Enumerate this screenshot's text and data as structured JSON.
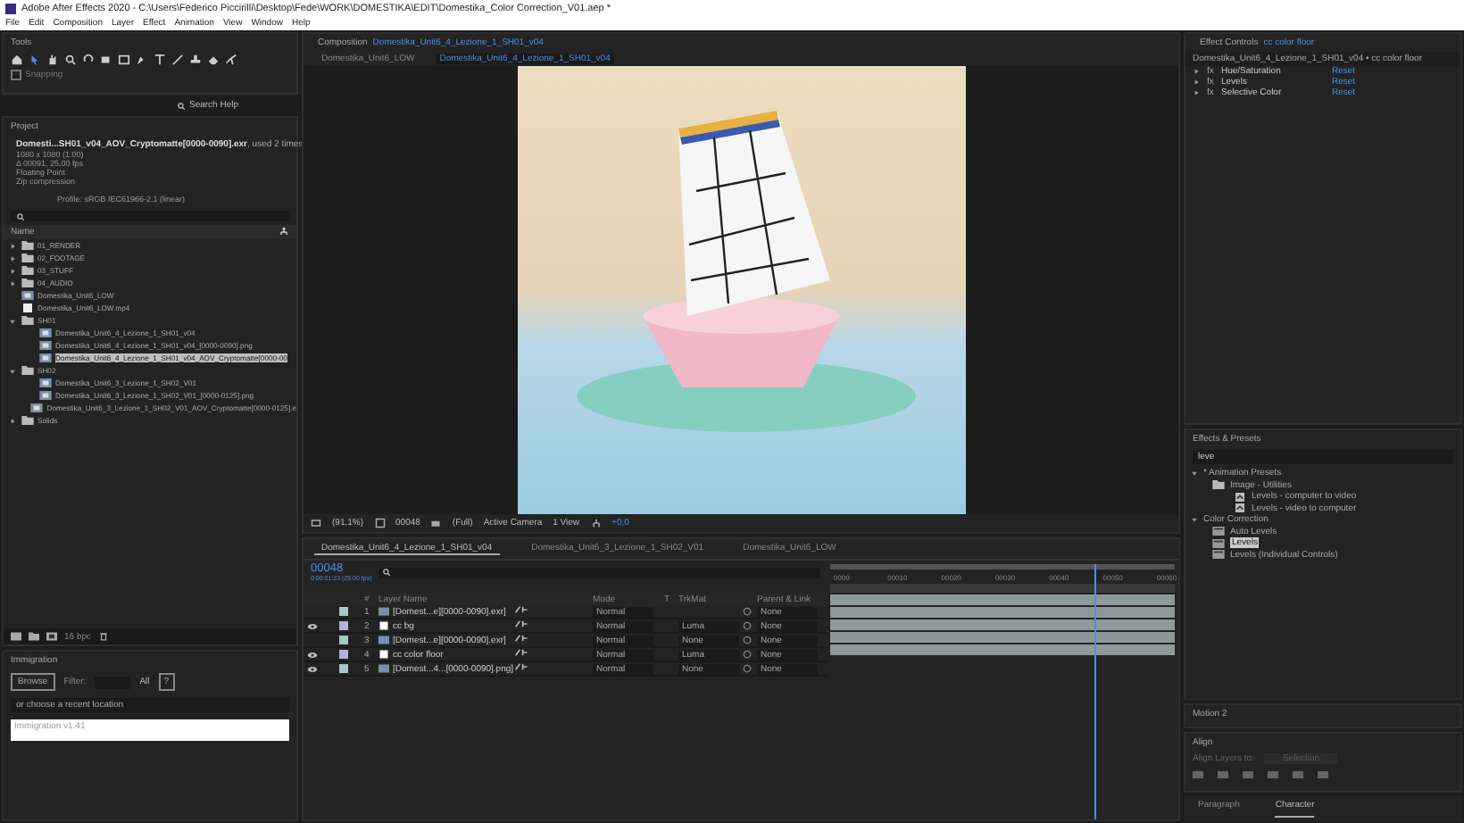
{
  "window": {
    "title": "Adobe After Effects 2020 - C:\\Users\\Federico Piccirilli\\Desktop\\Fede\\WORK\\DOMESTIKA\\EDIT\\Domestika_Color Correction_V01.aep *"
  },
  "menu": [
    "File",
    "Edit",
    "Composition",
    "Layer",
    "Effect",
    "Animation",
    "View",
    "Window",
    "Help"
  ],
  "tools": {
    "title": "Tools",
    "snapping": {
      "label": "Snapping",
      "checked": false
    },
    "search_placeholder": "Search Help"
  },
  "project": {
    "title": "Project",
    "selected_name": "Domesti...SH01_v04_AOV_Cryptomatte[0000-0090].exr",
    "used": ", used 2 times",
    "details": [
      "1080 x 1080 (1.00)",
      "Δ 00091, 25,00 fps",
      "Floating Point",
      "Zip compression"
    ],
    "profile": "Profile: sRGB IEC61966-2.1 (linear)",
    "column": "Name",
    "bpc": "16 bpc",
    "items": [
      {
        "name": "01_RENDER",
        "kind": "folder",
        "expanded": false,
        "selected": false
      },
      {
        "name": "02_FOOTAGE",
        "kind": "folder",
        "expanded": false,
        "selected": false
      },
      {
        "name": "03_STUFF",
        "kind": "folder",
        "expanded": false,
        "selected": false
      },
      {
        "name": "04_AUDIO",
        "kind": "folder",
        "expanded": false,
        "selected": false
      },
      {
        "name": "Domestika_Unit6_LOW",
        "kind": "comp",
        "selected": false
      },
      {
        "name": "Domestika_Unit6_LOW.mp4",
        "kind": "file",
        "selected": false
      },
      {
        "name": "SH01",
        "kind": "folder",
        "expanded": true,
        "selected": false,
        "children": [
          {
            "name": "Domestika_Unit6_4_Lezione_1_SH01_v04",
            "kind": "comp",
            "selected": false
          },
          {
            "name": "Domestika_Unit6_4_Lezione_1_SH01_v04_[0000-0090].png",
            "kind": "comp",
            "selected": false
          },
          {
            "name": "Domestika_Unit6_4_Lezione_1_SH01_v04_AOV_Cryptomatte[0000-00",
            "kind": "comp",
            "selected": true
          }
        ]
      },
      {
        "name": "SH02",
        "kind": "folder",
        "expanded": true,
        "selected": false,
        "children": [
          {
            "name": "Domestika_Unit6_3_Lezione_1_SH02_V01",
            "kind": "comp",
            "selected": false
          },
          {
            "name": "Domestika_Unit6_3_Lezione_1_SH02_V01_[0000-0125].png",
            "kind": "comp",
            "selected": false
          },
          {
            "name": "Domestika_Unit6_3_Lezione_1_SH02_V01_AOV_Cryptomatte[0000-0125].e",
            "kind": "comp",
            "selected": false
          }
        ]
      },
      {
        "name": "Solids",
        "kind": "folder",
        "expanded": false,
        "selected": false
      }
    ]
  },
  "immigration": {
    "title": "Immigration",
    "browse": "Browse",
    "filter_label": "Filter:",
    "filter_value": "All",
    "help": "?",
    "recent": "or choose a recent location",
    "field": "Immigration v1.41"
  },
  "composition": {
    "label": "Composition",
    "name": "Domestika_Unit6_4_Lezione_1_SH01_v04",
    "tabs": [
      {
        "label": "Domestika_Unit6_LOW",
        "selected": false
      },
      {
        "label": "Domestika_Unit6_4_Lezione_1_SH01_v04",
        "selected": true
      }
    ],
    "toolbar": {
      "zoom": "(91,1%)",
      "time": "00048",
      "resolution": "(Full)",
      "camera": "Active Camera",
      "views": "1 View",
      "exposure": "+0,0"
    }
  },
  "timeline": {
    "tabs": [
      {
        "label": "Domestika_Unit6_4_Lezione_1_SH01_v04",
        "selected": true
      },
      {
        "label": "Domestika_Unit6_3_Lezione_1_SH02_V01",
        "selected": false
      },
      {
        "label": "Domestika_Unit6_LOW",
        "selected": false
      }
    ],
    "timecode": "00048",
    "timecode_sub": "0:00:01:23 (25.00 fps)",
    "columns": {
      "number": "#",
      "name": "Layer Name",
      "mode": "Mode",
      "t": "T",
      "trkmat": "TrkMat",
      "parent": "Parent & Link"
    },
    "layers": [
      {
        "number": "1",
        "name": "[Domest...e][0000-0090].exr]",
        "kind": "footage",
        "visible": false,
        "color": "#a4c8c8",
        "mode": "Normal",
        "parent": "None"
      },
      {
        "number": "2",
        "name": "cc bg",
        "kind": "solid",
        "visible": true,
        "color": "#b4b4d8",
        "mode": "Normal",
        "trkmat": "Luma",
        "parent": "None"
      },
      {
        "number": "3",
        "name": "[Domest...e][0000-0090].exr]",
        "kind": "footage",
        "visible": false,
        "color": "#a4c8c8",
        "mode": "Normal",
        "trkmat": "None",
        "parent": "None"
      },
      {
        "number": "4",
        "name": "cc color floor",
        "kind": "solid",
        "visible": true,
        "color": "#b4b4d8",
        "mode": "Normal",
        "trkmat": "Luma",
        "parent": "None"
      },
      {
        "number": "5",
        "name": "[Domest...4...[0000-0090].png]",
        "kind": "footage",
        "visible": true,
        "color": "#a4c8c8",
        "mode": "Normal",
        "trkmat": "None",
        "parent": "None"
      }
    ],
    "ruler": [
      "0000",
      "00010",
      "00020",
      "00030",
      "00040",
      "00050",
      "00060"
    ],
    "playhead": {
      "level": 0.8
    }
  },
  "effect_controls": {
    "label": "Effect Controls",
    "layer": "cc color floor",
    "subtitle": "Domestika_Unit6_4_Lezione_1_SH01_v04 • cc color floor",
    "effects": [
      {
        "fx": "fx",
        "name": "Hue/Saturation",
        "reset": "Reset"
      },
      {
        "fx": "fx",
        "name": "Levels",
        "reset": "Reset"
      },
      {
        "fx": "fx",
        "name": "Selective Color",
        "reset": "Reset"
      }
    ]
  },
  "effects_presets": {
    "title": "Effects & Presets",
    "search": "leve",
    "tree": [
      {
        "name": "* Animation Presets",
        "kind": "category",
        "selected": false,
        "children": [
          {
            "name": "Image - Utilities",
            "kind": "folder",
            "selected": false,
            "children": [
              {
                "name": "Levels - computer to video",
                "kind": "preset",
                "selected": false
              },
              {
                "name": "Levels - video to computer",
                "kind": "preset",
                "selected": false
              }
            ]
          }
        ]
      },
      {
        "name": "Color Correction",
        "kind": "category",
        "selected": false,
        "children": [
          {
            "name": "Auto Levels",
            "kind": "effect",
            "selected": false
          },
          {
            "name": "Levels",
            "kind": "effect",
            "selected": true
          },
          {
            "name": "Levels (Individual Controls)",
            "kind": "effect",
            "selected": false
          }
        ]
      }
    ]
  },
  "motion": {
    "title": "Motion 2"
  },
  "align": {
    "title": "Align",
    "label": "Align Layers to:",
    "target": "Selection"
  },
  "bottom_tabs": [
    {
      "label": "Paragraph",
      "selected": false
    },
    {
      "label": "Character",
      "selected": true
    }
  ]
}
